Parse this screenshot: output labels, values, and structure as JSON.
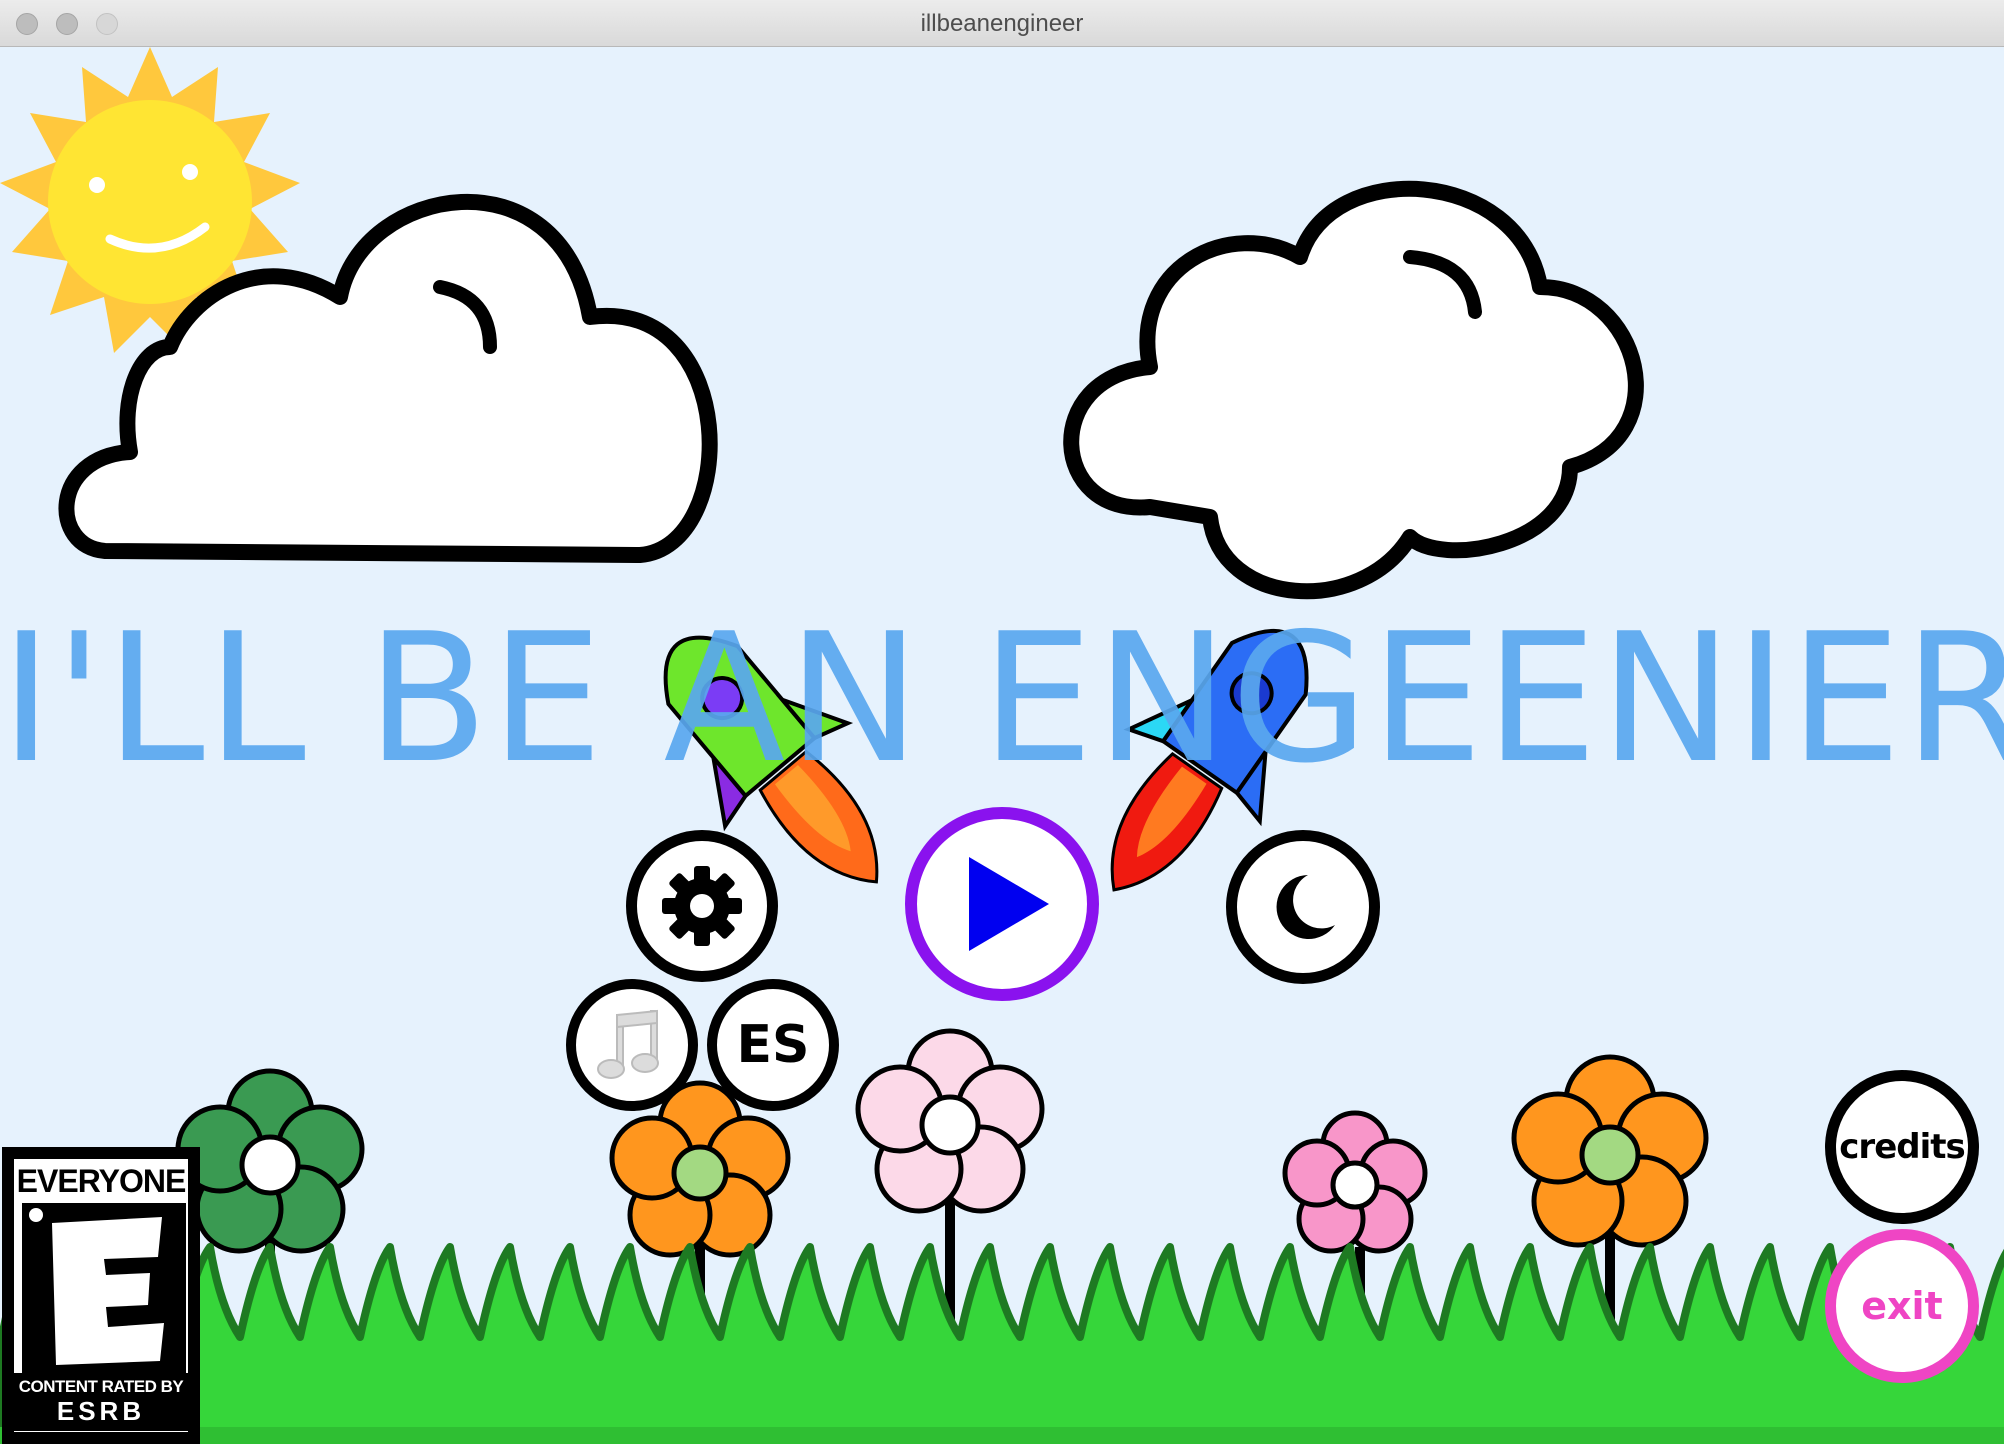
{
  "window": {
    "title": "illbeanengineer"
  },
  "game": {
    "title": "I'LL BE AN ENGEENIER"
  },
  "menu": {
    "play_icon": "play-icon",
    "settings_icon": "gear-icon",
    "night_icon": "moon-icon",
    "music_icon": "music-note-icon",
    "language_label": "ES",
    "credits_label": "credits",
    "exit_label": "exit"
  },
  "rating": {
    "top_label": "EVERYONE",
    "letter": "E",
    "bottom_line1": "CONTENT RATED BY",
    "bottom_line2": "ESRB"
  },
  "colors": {
    "sky": "#e6f2fd",
    "title": "#5aa8ef",
    "grass": "#36d63a",
    "play_ring": "#8a12ee",
    "play_triangle": "#0000f0",
    "exit_ring": "#ef45c4"
  }
}
